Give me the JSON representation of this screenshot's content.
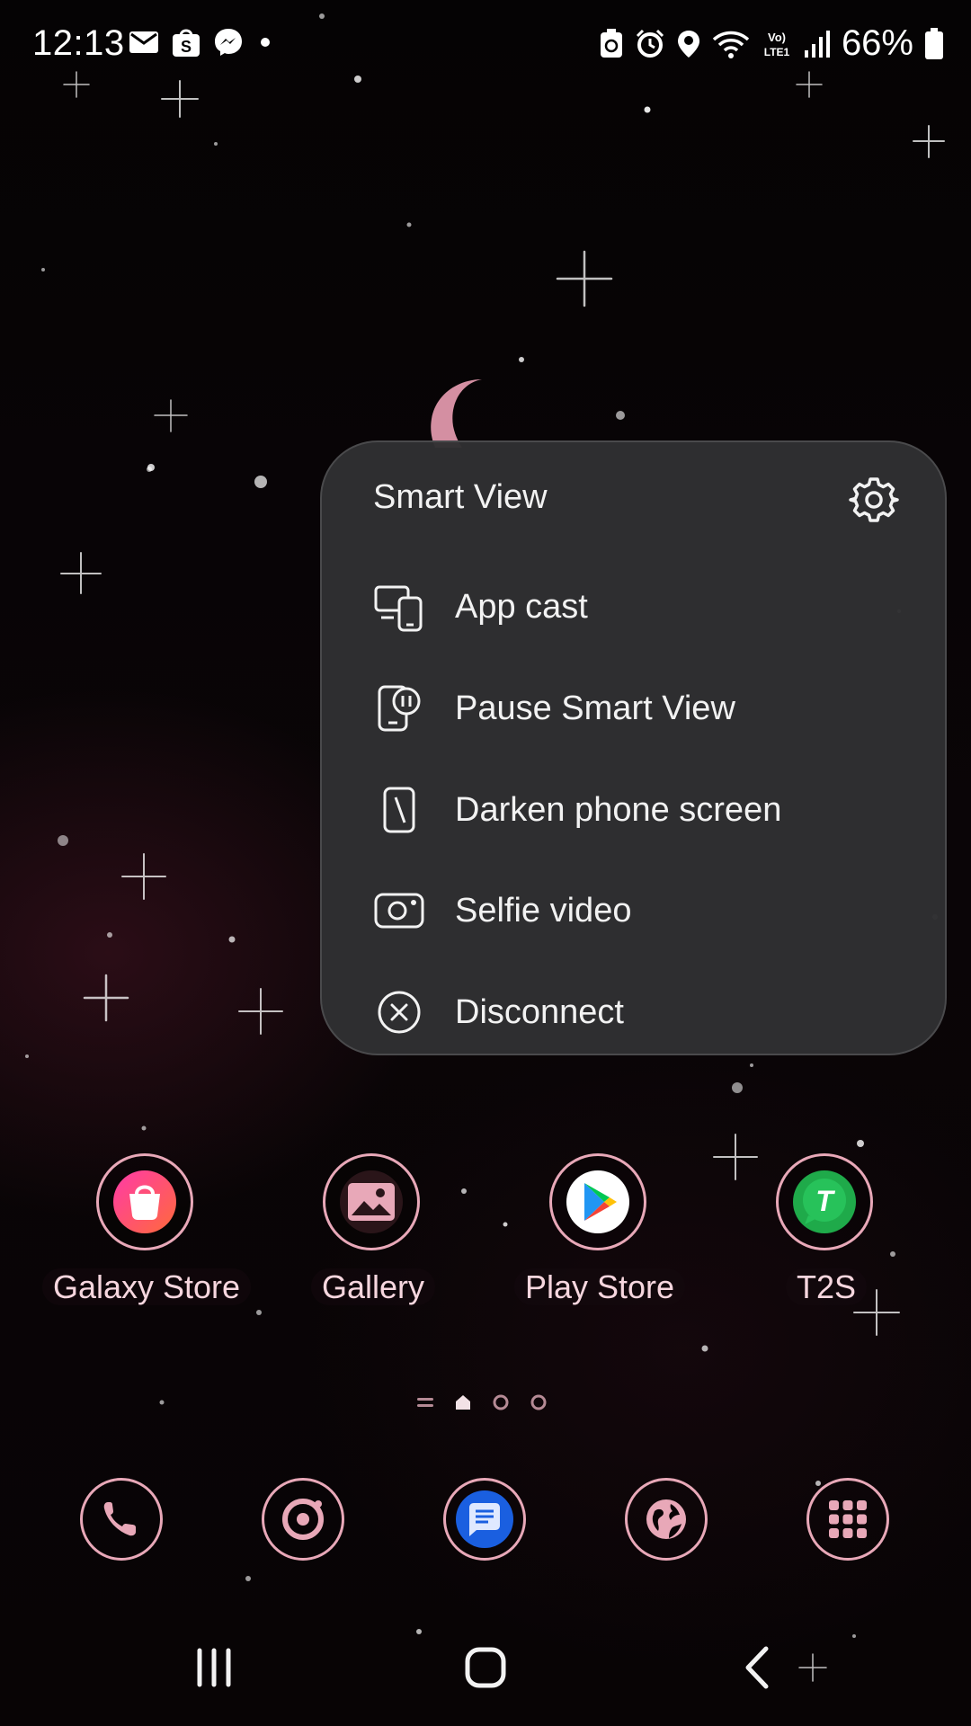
{
  "status_bar": {
    "time": "12:13",
    "battery_percent": "66%",
    "left_icons": [
      "gmail-icon",
      "shopee-icon",
      "messenger-icon",
      "dot-icon"
    ],
    "right_icons": [
      "recycle-icon",
      "alarm-icon",
      "location-icon",
      "wifi-icon",
      "volte-icon",
      "signal-icon",
      "battery-icon"
    ],
    "volte_text": "Vo) LTE1"
  },
  "smart_view_panel": {
    "title": "Smart View",
    "settings_icon": "gear-icon",
    "items": [
      {
        "label": "App cast",
        "icon": "app-cast-icon"
      },
      {
        "label": "Pause Smart View",
        "icon": "pause-smart-view-icon"
      },
      {
        "label": "Darken phone screen",
        "icon": "darken-screen-icon"
      },
      {
        "label": "Selfie video",
        "icon": "selfie-camera-icon"
      },
      {
        "label": "Disconnect",
        "icon": "disconnect-icon"
      }
    ]
  },
  "apps": [
    {
      "label": "Galaxy Store",
      "icon": "galaxy-store-icon"
    },
    {
      "label": "Gallery",
      "icon": "gallery-icon"
    },
    {
      "label": "Play Store",
      "icon": "play-store-icon"
    },
    {
      "label": "T2S",
      "icon": "t2s-icon"
    }
  ],
  "t2s_letter": "T",
  "page_indicator": {
    "pages": 3,
    "current_page": 1
  },
  "dock": [
    {
      "icon": "phone-icon"
    },
    {
      "icon": "camera-icon"
    },
    {
      "icon": "messages-icon"
    },
    {
      "icon": "internet-globe-icon"
    },
    {
      "icon": "apps-grid-icon"
    }
  ],
  "navigation_bar": [
    "recents-icon",
    "home-icon",
    "back-icon"
  ],
  "colors": {
    "accent_pink": "#e8a8b8",
    "panel_bg": "#303032",
    "text": "#f2f2f2"
  }
}
